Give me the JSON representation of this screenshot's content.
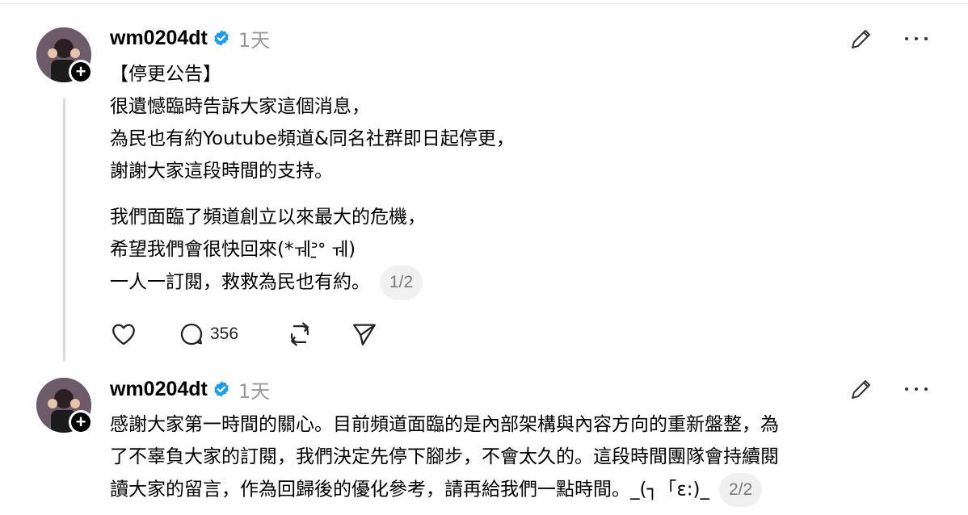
{
  "posts": [
    {
      "username": "wm0204dt",
      "time": "1天",
      "paragraphs": [
        [
          "【停更公告】",
          "很遺憾臨時告訴大家這個消息，",
          "為民也有約Youtube頻道&同名社群即日起停更，",
          "謝謝大家這段時間的支持。"
        ],
        [
          "我們面臨了頻道創立以來最大的危機，",
          "希望我們會很快回來(*ￕᐣ̱ᐤ ￕ)",
          "一人一訂閱，救救為民也有約。"
        ]
      ],
      "pager": "1/2",
      "reply_count": "356"
    },
    {
      "username": "wm0204dt",
      "time": "1天",
      "lines": [
        "感謝大家第一時間的關心。目前頻道面臨的是內部架構與內容方向的重新盤整，為",
        "了不辜負大家的訂閱，我們決定先停下腳步，不會太久的。這段時間團隊會持續閱",
        "讀大家的留言，作為回歸後的優化參考，請再給我們一點時間。_(┐「ε:)_"
      ],
      "pager": "2/2"
    }
  ],
  "icons": {
    "verified": "verified-badge-icon",
    "edit": "pencil-icon",
    "more": "more-icon",
    "like": "heart-icon",
    "reply": "comment-icon",
    "repost": "repost-icon",
    "share": "send-icon"
  },
  "colors": {
    "verified": "#1d9bf0",
    "muted": "#999999",
    "thread_line": "#d9d9d9"
  }
}
